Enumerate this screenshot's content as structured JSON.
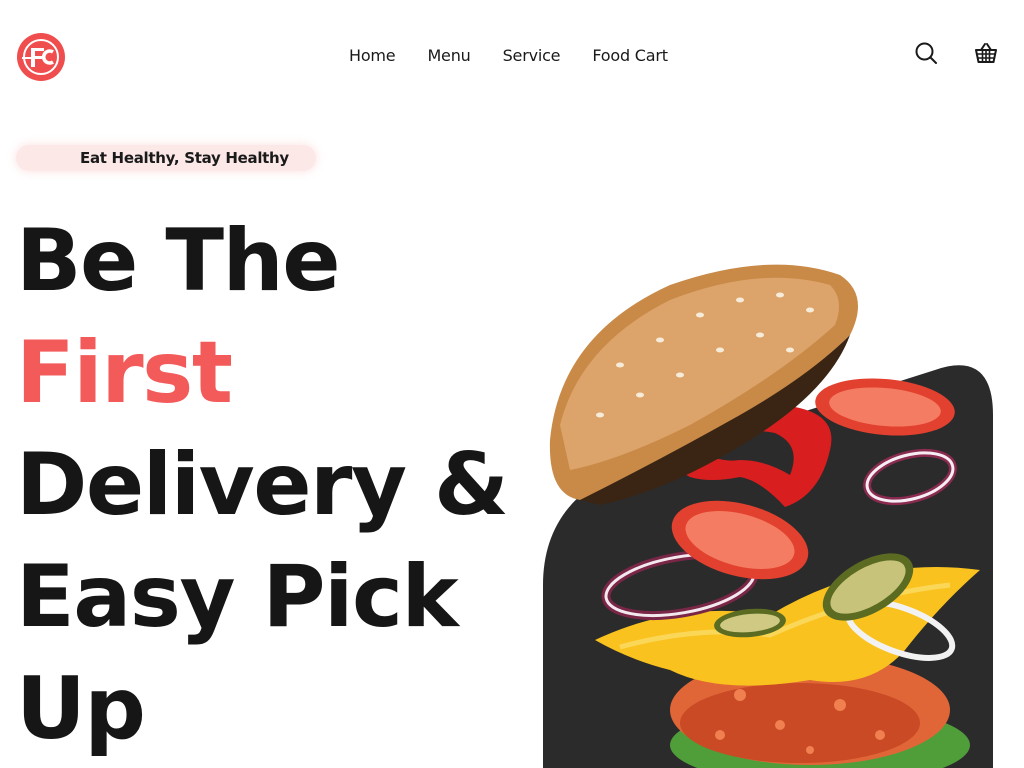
{
  "brand": {
    "logo_letters": "FC",
    "accent_color": "#f04e4e"
  },
  "nav": {
    "items": [
      {
        "label": "Home"
      },
      {
        "label": "Menu"
      },
      {
        "label": "Service"
      },
      {
        "label": "Food Cart"
      }
    ]
  },
  "header_icons": {
    "search": "search-icon",
    "cart": "basket-icon"
  },
  "hero": {
    "tagline": "Eat Healthy, Stay Healthy",
    "title_lines": [
      "Be The",
      "First",
      "Delivery &",
      "Easy Pick",
      "Up"
    ],
    "accent_line": "First",
    "accent_color": "#f35b5b",
    "image": "flying-burger-illustration",
    "image_backdrop_color": "#2b2b2b"
  }
}
